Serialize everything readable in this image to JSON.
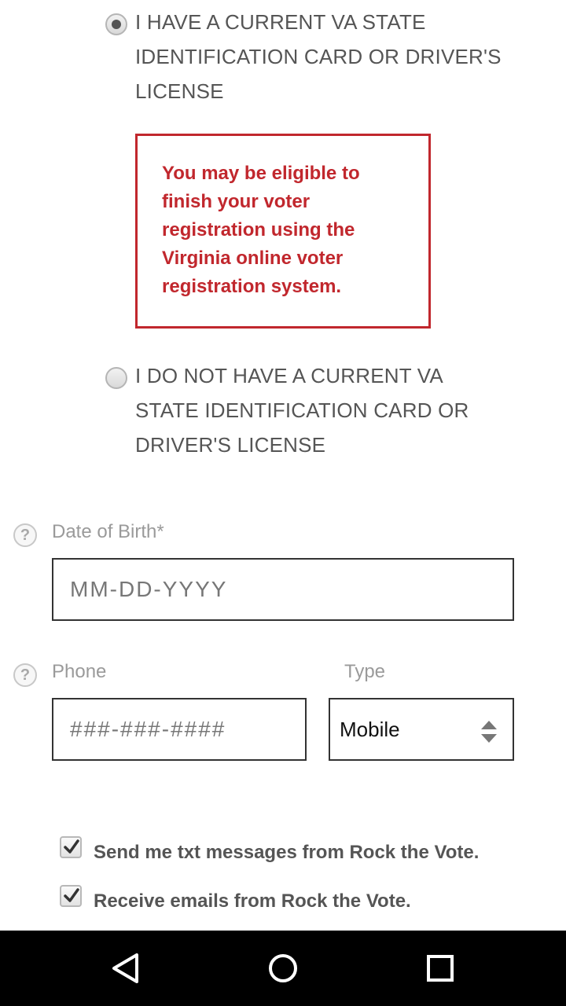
{
  "id_options": {
    "has_id": {
      "label": "I HAVE A CURRENT VA STATE IDENTIFICATION CARD OR DRIVER'S LICENSE",
      "selected": true
    },
    "no_id": {
      "label": "I DO NOT HAVE A CURRENT VA STATE IDENTIFICATION CARD OR DRIVER'S LICENSE",
      "selected": false
    }
  },
  "alert": {
    "message": "You may be eligible to finish your voter registration using the Virginia online voter registration system.",
    "color": "#c1272d"
  },
  "dob": {
    "label": "Date of Birth*",
    "placeholder": "MM-DD-YYYY",
    "help_icon": "question-icon"
  },
  "phone": {
    "label": "Phone",
    "placeholder": "###-###-####",
    "help_icon": "question-icon",
    "type_label": "Type",
    "type_value": "Mobile"
  },
  "opt_ins": [
    {
      "label": "Send me txt messages from Rock the Vote.",
      "checked": true
    },
    {
      "label": "Receive emails from Rock the Vote.",
      "checked": true
    }
  ],
  "nav": {
    "back_icon": "triangle-back-icon",
    "home_icon": "circle-home-icon",
    "recents_icon": "square-recents-icon"
  }
}
